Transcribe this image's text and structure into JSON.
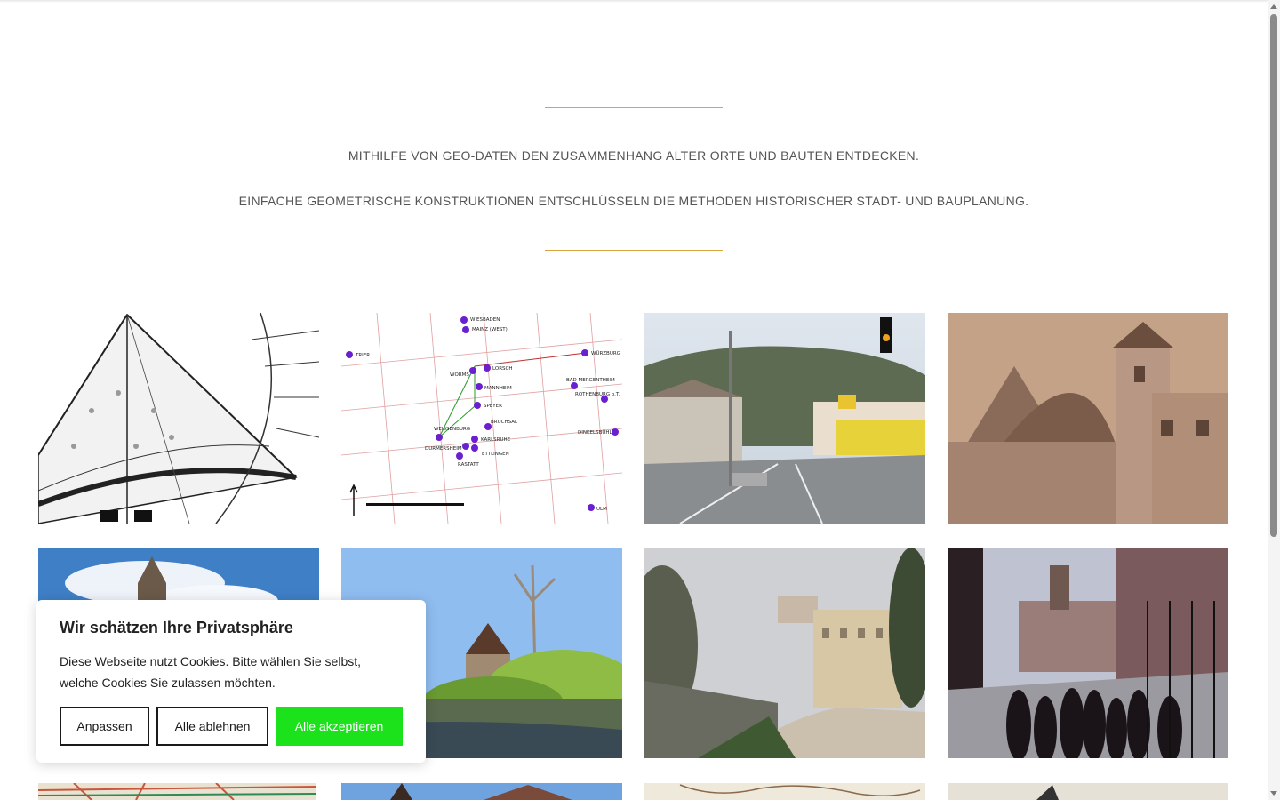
{
  "hero": {
    "line1": "MITHILFE VON GEO-DATEN DEN ZUSAMMENHANG ALTER ORTE UND BAUTEN ENTDECKEN.",
    "line2": "EINFACHE GEOMETRISCHE KONSTRUKTIONEN ENTSCHLÜSSELN DIE METHODEN HISTORISCHER STADT- UND BAUPLANUNG."
  },
  "gallery": {
    "map_labels": [
      "WIESBADEN",
      "MAINZ (WEST)",
      "TRIER",
      "WORMS",
      "LORSCH",
      "WÜRZBURG",
      "MANNHEIM",
      "BAD MERGENTHEIM",
      "ROTHENBURG o.T.",
      "SPEYER",
      "BRUCHSAL",
      "WEISSENBURG",
      "KARLSRUHE",
      "DURMERSHEIM",
      "ETTLINGEN",
      "RASTATT",
      "DINKELSBÜHL",
      "ULM"
    ]
  },
  "cookie": {
    "title": "Wir schätzen Ihre Privatsphäre",
    "text": "Diese Webseite nutzt Cookies. Bitte wählen Sie selbst, welche Cookies Sie zulassen möchten.",
    "customize_label": "Anpassen",
    "reject_label": "Alle ablehnen",
    "accept_label": "Alle akzeptieren"
  },
  "colors": {
    "accent": "#d9a441",
    "accept_button": "#1ce21c",
    "text": "#555555"
  }
}
